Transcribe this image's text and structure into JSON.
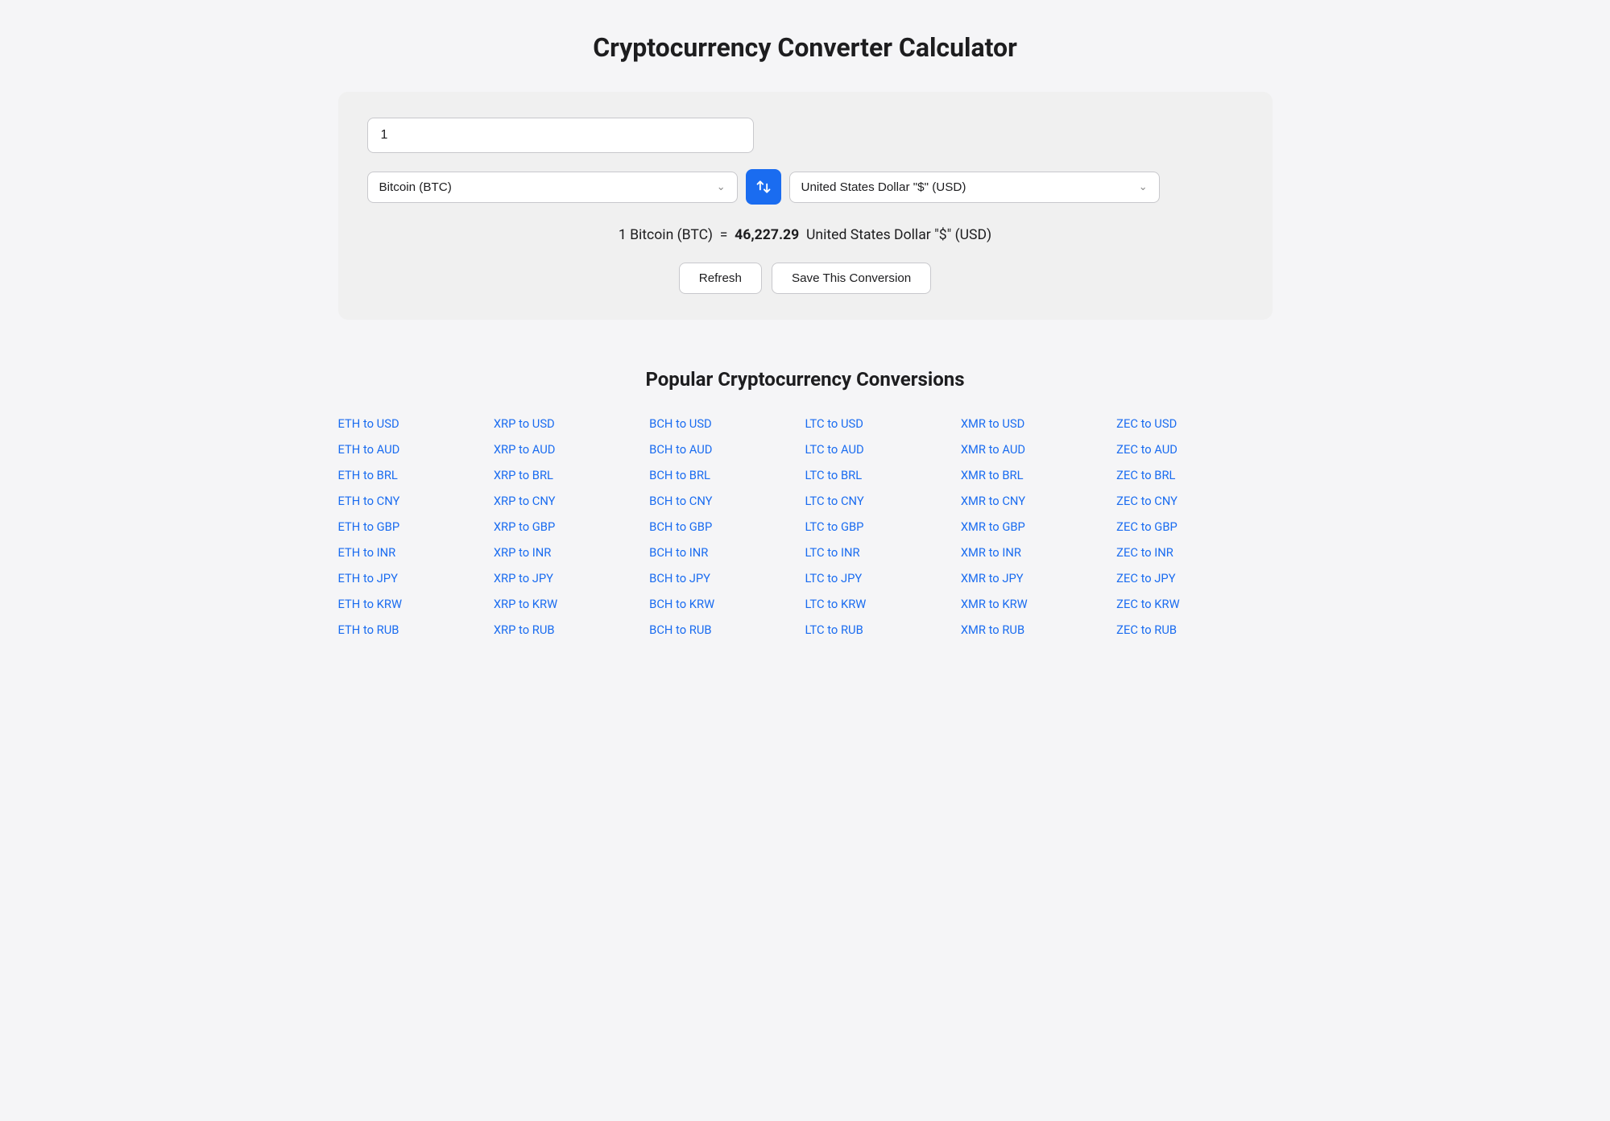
{
  "page": {
    "title": "Cryptocurrency Converter Calculator"
  },
  "converter": {
    "amount_value": "1",
    "from_currency": "Bitcoin (BTC)",
    "to_currency": "United States Dollar \"$\" (USD)",
    "result_text": "1 Bitcoin (BTC)",
    "equals": "=",
    "result_value": "46,227.29",
    "result_currency": "United States Dollar \"$\" (USD)",
    "refresh_label": "Refresh",
    "save_label": "Save This Conversion",
    "swap_icon": "⇄"
  },
  "popular": {
    "title": "Popular Cryptocurrency Conversions",
    "columns": [
      {
        "items": [
          "ETH to USD",
          "ETH to AUD",
          "ETH to BRL",
          "ETH to CNY",
          "ETH to GBP",
          "ETH to INR",
          "ETH to JPY",
          "ETH to KRW",
          "ETH to RUB"
        ]
      },
      {
        "items": [
          "XRP to USD",
          "XRP to AUD",
          "XRP to BRL",
          "XRP to CNY",
          "XRP to GBP",
          "XRP to INR",
          "XRP to JPY",
          "XRP to KRW",
          "XRP to RUB"
        ]
      },
      {
        "items": [
          "BCH to USD",
          "BCH to AUD",
          "BCH to BRL",
          "BCH to CNY",
          "BCH to GBP",
          "BCH to INR",
          "BCH to JPY",
          "BCH to KRW",
          "BCH to RUB"
        ]
      },
      {
        "items": [
          "LTC to USD",
          "LTC to AUD",
          "LTC to BRL",
          "LTC to CNY",
          "LTC to GBP",
          "LTC to INR",
          "LTC to JPY",
          "LTC to KRW",
          "LTC to RUB"
        ]
      },
      {
        "items": [
          "XMR to USD",
          "XMR to AUD",
          "XMR to BRL",
          "XMR to CNY",
          "XMR to GBP",
          "XMR to INR",
          "XMR to JPY",
          "XMR to KRW",
          "XMR to RUB"
        ]
      },
      {
        "items": [
          "ZEC to USD",
          "ZEC to AUD",
          "ZEC to BRL",
          "ZEC to CNY",
          "ZEC to GBP",
          "ZEC to INR",
          "ZEC to JPY",
          "ZEC to KRW",
          "ZEC to RUB"
        ]
      }
    ]
  }
}
